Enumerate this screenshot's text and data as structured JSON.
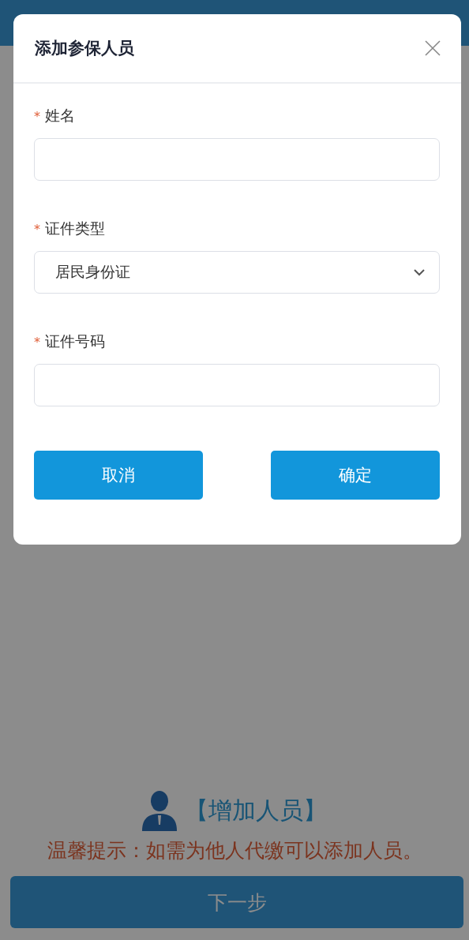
{
  "add_person": {
    "label": "【增加人员】"
  },
  "tip": "温馨提示：如需为他人代缴可以添加人员。",
  "next_button": "下一步",
  "dialog": {
    "title": "添加参保人员",
    "fields": [
      {
        "kind": "input",
        "label": "姓名",
        "required_mark": "*"
      },
      {
        "kind": "select",
        "label": "证件类型",
        "required_mark": "*",
        "value": "居民身份证"
      },
      {
        "kind": "input",
        "label": "证件号码",
        "required_mark": "*"
      }
    ],
    "buttons": [
      "取消",
      "确定"
    ]
  }
}
